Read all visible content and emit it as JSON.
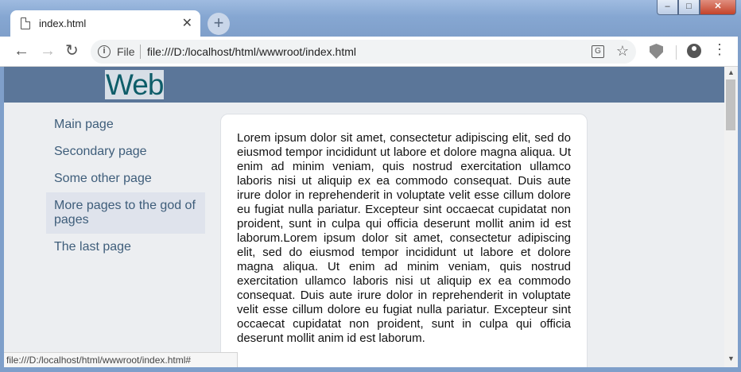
{
  "browser": {
    "tab": {
      "title": "index.html",
      "close": "✕"
    },
    "new_tab": "+",
    "window_buttons": {
      "minimize": "‒",
      "maximize": "□",
      "close": "✕"
    },
    "nav": {
      "back": "←",
      "forward": "→",
      "reload": "↻"
    },
    "omnibox": {
      "info": "i",
      "scheme_label": "File",
      "url": "file:///D:/localhost/html/wwwroot/index.html",
      "star": "☆",
      "translate": "G"
    },
    "menu": "⋮",
    "status_url": "file:///D:/localhost/html/wwwroot/index.html#"
  },
  "site": {
    "logo": "Web",
    "nav": [
      {
        "label": "Main page",
        "active": false
      },
      {
        "label": "Secondary page",
        "active": false
      },
      {
        "label": "Some other page",
        "active": false
      },
      {
        "label": "More pages to the god of pages",
        "active": true
      },
      {
        "label": "The last page",
        "active": false
      }
    ],
    "content": "Lorem ipsum dolor sit amet, consectetur adipiscing elit, sed do eiusmod tempor incididunt ut labore et dolore magna aliqua. Ut enim ad minim veniam, quis nostrud exercitation ullamco laboris nisi ut aliquip ex ea commodo consequat. Duis aute irure dolor in reprehenderit in voluptate velit esse cillum dolore eu fugiat nulla pariatur. Excepteur sint occaecat cupidatat non proident, sunt in culpa qui officia deserunt mollit anim id est laborum.Lorem ipsum dolor sit amet, consectetur adipiscing elit, sed do eiusmod tempor incididunt ut labore et dolore magna aliqua. Ut enim ad minim veniam, quis nostrud exercitation ullamco laboris nisi ut aliquip ex ea commodo consequat. Duis aute irure dolor in reprehenderit in voluptate velit esse cillum dolore eu fugiat nulla pariatur. Excepteur sint occaecat cupidatat non proident, sunt in culpa qui officia deserunt mollit anim id est laborum."
  },
  "scrollbar": {
    "up": "▲",
    "down": "▼"
  },
  "colors": {
    "header": "#5b7699",
    "logo_text": "#0e5d69",
    "nav_link": "#3e5d7a",
    "page_bg": "#eceef1",
    "active_nav_bg": "#dfe3ec"
  }
}
